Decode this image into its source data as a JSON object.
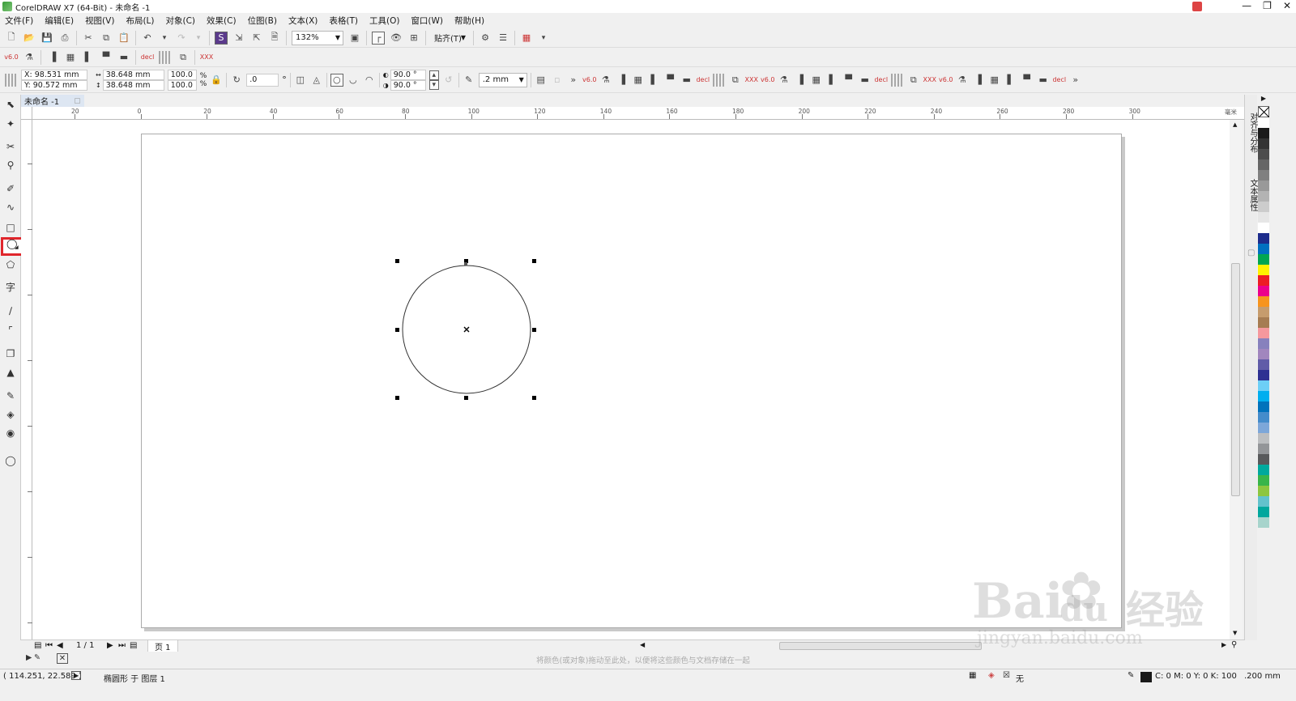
{
  "window": {
    "title": "CorelDRAW X7 (64-Bit) - 未命名 -1"
  },
  "menu": [
    "文件(F)",
    "编辑(E)",
    "视图(V)",
    "布局(L)",
    "对象(C)",
    "效果(C)",
    "位图(B)",
    "文本(X)",
    "表格(T)",
    "工具(O)",
    "窗口(W)",
    "帮助(H)"
  ],
  "toolbar": {
    "zoom": "132%",
    "snap_label": "贴齐(T)"
  },
  "propbar": {
    "x": "X: 98.531 mm",
    "y": "Y: 90.572 mm",
    "width": "38.648 mm",
    "height": "38.648 mm",
    "scale_x": "100.0",
    "scale_y": "100.0",
    "percent": "%",
    "rotation": ".0",
    "degree": "°",
    "angle_start": "90.0 °",
    "angle_end": "90.0 °",
    "outline_width": ".2 mm"
  },
  "doc_tab": {
    "name": "未命名 -1"
  },
  "ruler": {
    "h_ticks": [
      "20",
      "0",
      "20",
      "40",
      "60",
      "80",
      "100",
      "120",
      "140",
      "160",
      "180",
      "200",
      "220",
      "240",
      "260",
      "280",
      "300"
    ],
    "unit": "毫米"
  },
  "page_nav": {
    "counter": "1 / 1",
    "page_tab": "页 1"
  },
  "hint": "将颜色(或对象)拖动至此处，以便将这些颜色与文档存储在一起",
  "dockers": {
    "align": "对齐与分布",
    "text": "文本属性"
  },
  "status": {
    "coords": "( 114.251, 22.589 )",
    "object_info": "椭圆形 于 图层 1",
    "fill": "无",
    "color_info": "C: 0 M: 0 Y: 0 K: 100",
    "outline": ".200 mm"
  },
  "watermark": {
    "brand": "Bai",
    "brand2": "du",
    "cn": "经验",
    "url": "jingyan.baidu.com"
  },
  "palette_colors": [
    "#ffffff",
    "#1a1a1a",
    "#333333",
    "#4d4d4d",
    "#666666",
    "#808080",
    "#999999",
    "#b3b3b3",
    "#cccccc",
    "#e6e6e6",
    "#ffffff",
    "#1d2c8c",
    "#0070c0",
    "#00a651",
    "#fff200",
    "#ed1c24",
    "#ec008c",
    "#f7941d",
    "#c69c6d",
    "#a67c52",
    "#f5989d",
    "#8781bd",
    "#a186be",
    "#605ca8",
    "#2e3192",
    "#6dcff6",
    "#00aeef",
    "#0072bc",
    "#448ccb",
    "#7da7d9",
    "#bcbec0",
    "#939598",
    "#58595b",
    "#00a99d",
    "#39b54a",
    "#8dc63f",
    "#62c2cc",
    "#00a79d",
    "#a7d4cc"
  ]
}
